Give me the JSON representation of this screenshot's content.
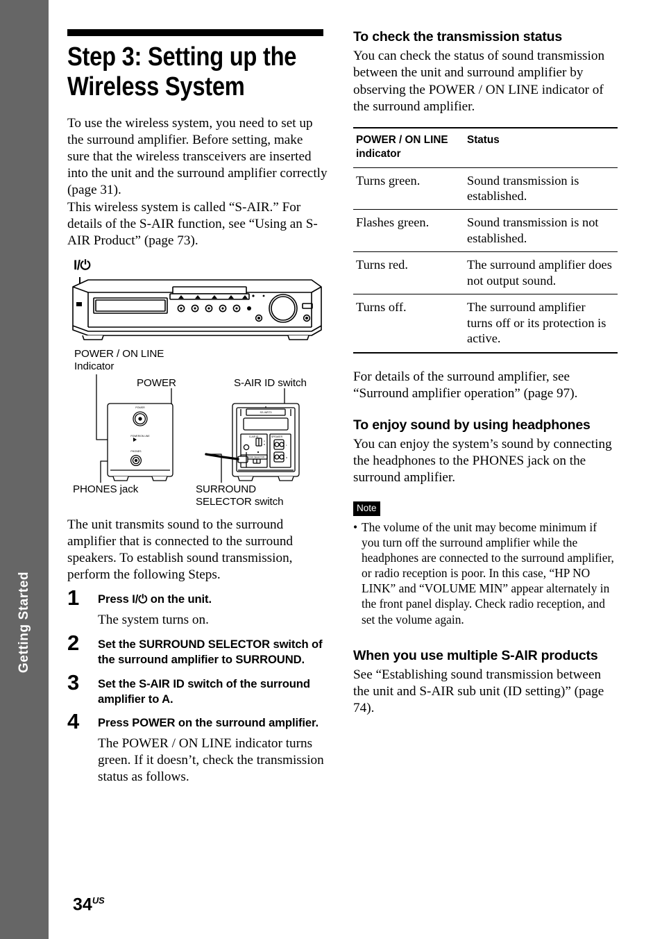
{
  "sidebar": {
    "tab_label": "Getting Started"
  },
  "left_column": {
    "title": "Step 3: Setting up the Wireless System",
    "intro_paragraphs": [
      "To use the wireless system, you need to set up the surround amplifier. Before setting, make sure that the wireless transceivers are inserted into the unit and the surround amplifier correctly (page 31).",
      "This wireless system is called “S-AIR.” For details of the S-AIR function, see “Using an S-AIR Product” (page 73)."
    ],
    "receiver_diagram": {
      "power_symbol": "I/⏻"
    },
    "amp_diagram": {
      "label_power_on_line": "POWER / ON LINE",
      "label_indicator": "Indicator",
      "label_power": "POWER",
      "label_sair_id": "S-AIR ID switch",
      "label_phones": "PHONES jack",
      "label_surround_1": "SURROUND",
      "label_surround_2": "SELECTOR switch",
      "rear_model_text": "SS-WRT3"
    },
    "transmit_paragraph": "The unit transmits sound to the surround amplifier that is connected to the surround speakers. To establish sound transmission, perform the following Steps.",
    "steps": [
      {
        "number": "1",
        "title": "Press I/⏻ on the unit.",
        "desc": "The system turns on."
      },
      {
        "number": "2",
        "title": "Set the SURROUND SELECTOR switch of the surround amplifier to SURROUND.",
        "desc": ""
      },
      {
        "number": "3",
        "title": "Set the S-AIR ID switch of the surround amplifier to A.",
        "desc": ""
      },
      {
        "number": "4",
        "title": "Press POWER on the surround amplifier.",
        "desc": "The POWER / ON LINE indicator turns green. If it doesn’t, check the transmission status as follows."
      }
    ]
  },
  "right_column": {
    "heading_check": "To check the transmission status",
    "check_paragraph": "You can check the status of sound transmission between the unit and surround amplifier by observing the POWER / ON LINE indicator of the surround amplifier.",
    "table": {
      "headers": [
        "POWER / ON LINE indicator",
        "Status"
      ],
      "rows": [
        [
          "Turns green.",
          "Sound transmission is established."
        ],
        [
          "Flashes green.",
          "Sound transmission is not established."
        ],
        [
          "Turns red.",
          "The surround amplifier does not output sound."
        ],
        [
          "Turns off.",
          "The surround amplifier turns off or its protection is active."
        ]
      ]
    },
    "details_paragraph": "For details of the surround amplifier, see “Surround amplifier operation” (page 97).",
    "heading_headphones": "To enjoy sound by using headphones",
    "headphones_paragraph": "You can enjoy the system’s sound by connecting the headphones to the PHONES jack on the surround amplifier.",
    "note_badge": "Note",
    "note_items": [
      "The volume of the unit may become minimum if you turn off the surround amplifier while the headphones are connected to the surround amplifier, or radio reception is poor. In this case, “HP NO LINK” and “VOLUME MIN” appear alternately in the front panel display. Check radio reception, and set the volume again."
    ],
    "heading_multiple": "When you use multiple S-AIR products",
    "multiple_paragraph": "See “Establishing sound transmission between the unit and S-AIR sub unit (ID setting)” (page 74)."
  },
  "footer": {
    "page_number": "34",
    "page_suffix": "US"
  },
  "colors": {
    "sidebar_gray": "#666666",
    "ink": "#000000",
    "paper": "#ffffff"
  }
}
